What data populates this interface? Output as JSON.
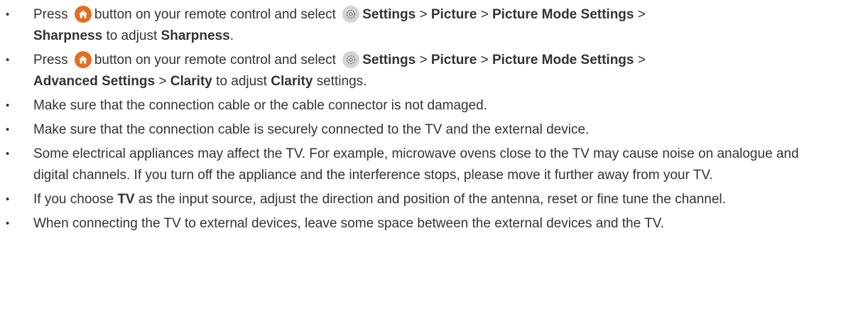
{
  "items": [
    {
      "type": "nav",
      "t1": "Press",
      "t2": "button on your remote control and select",
      "settings": "Settings",
      "sep": ">",
      "picture": "Picture",
      "mode": "Picture Mode Settings",
      "path_end": "Sharpness",
      "to_adjust": "to adjust",
      "target": "Sharpness",
      "end": "."
    },
    {
      "type": "nav",
      "t1": "Press",
      "t2": "button on your remote control and select",
      "settings": "Settings",
      "sep": ">",
      "picture": "Picture",
      "mode": "Picture Mode Settings",
      "advanced": "Advanced Settings",
      "path_end": "Clarity",
      "to_adjust": "to adjust",
      "target": "Clarity",
      "end": "settings."
    },
    {
      "type": "text",
      "text": "Make sure that the connection cable or the cable connector is not damaged."
    },
    {
      "type": "text",
      "text": "Make sure that the connection cable is securely connected to the TV and the external device."
    },
    {
      "type": "text",
      "text": "Some electrical appliances may affect the TV. For example, microwave ovens close to the TV may cause noise on analogue and digital channels. If you turn off the appliance and the interference stops, please move it further away from your TV."
    },
    {
      "type": "tv",
      "pre": "If you choose",
      "bold": "TV",
      "post": "as the input source, adjust the direction and position of the antenna, reset or fine tune the channel."
    },
    {
      "type": "text",
      "text": "When connecting the TV to external devices, leave some space between the external devices and the TV."
    }
  ],
  "icons": {
    "home": "home-icon",
    "settings": "settings-gear-icon",
    "home_color": "#e07020",
    "settings_color": "#cfcfcf"
  }
}
